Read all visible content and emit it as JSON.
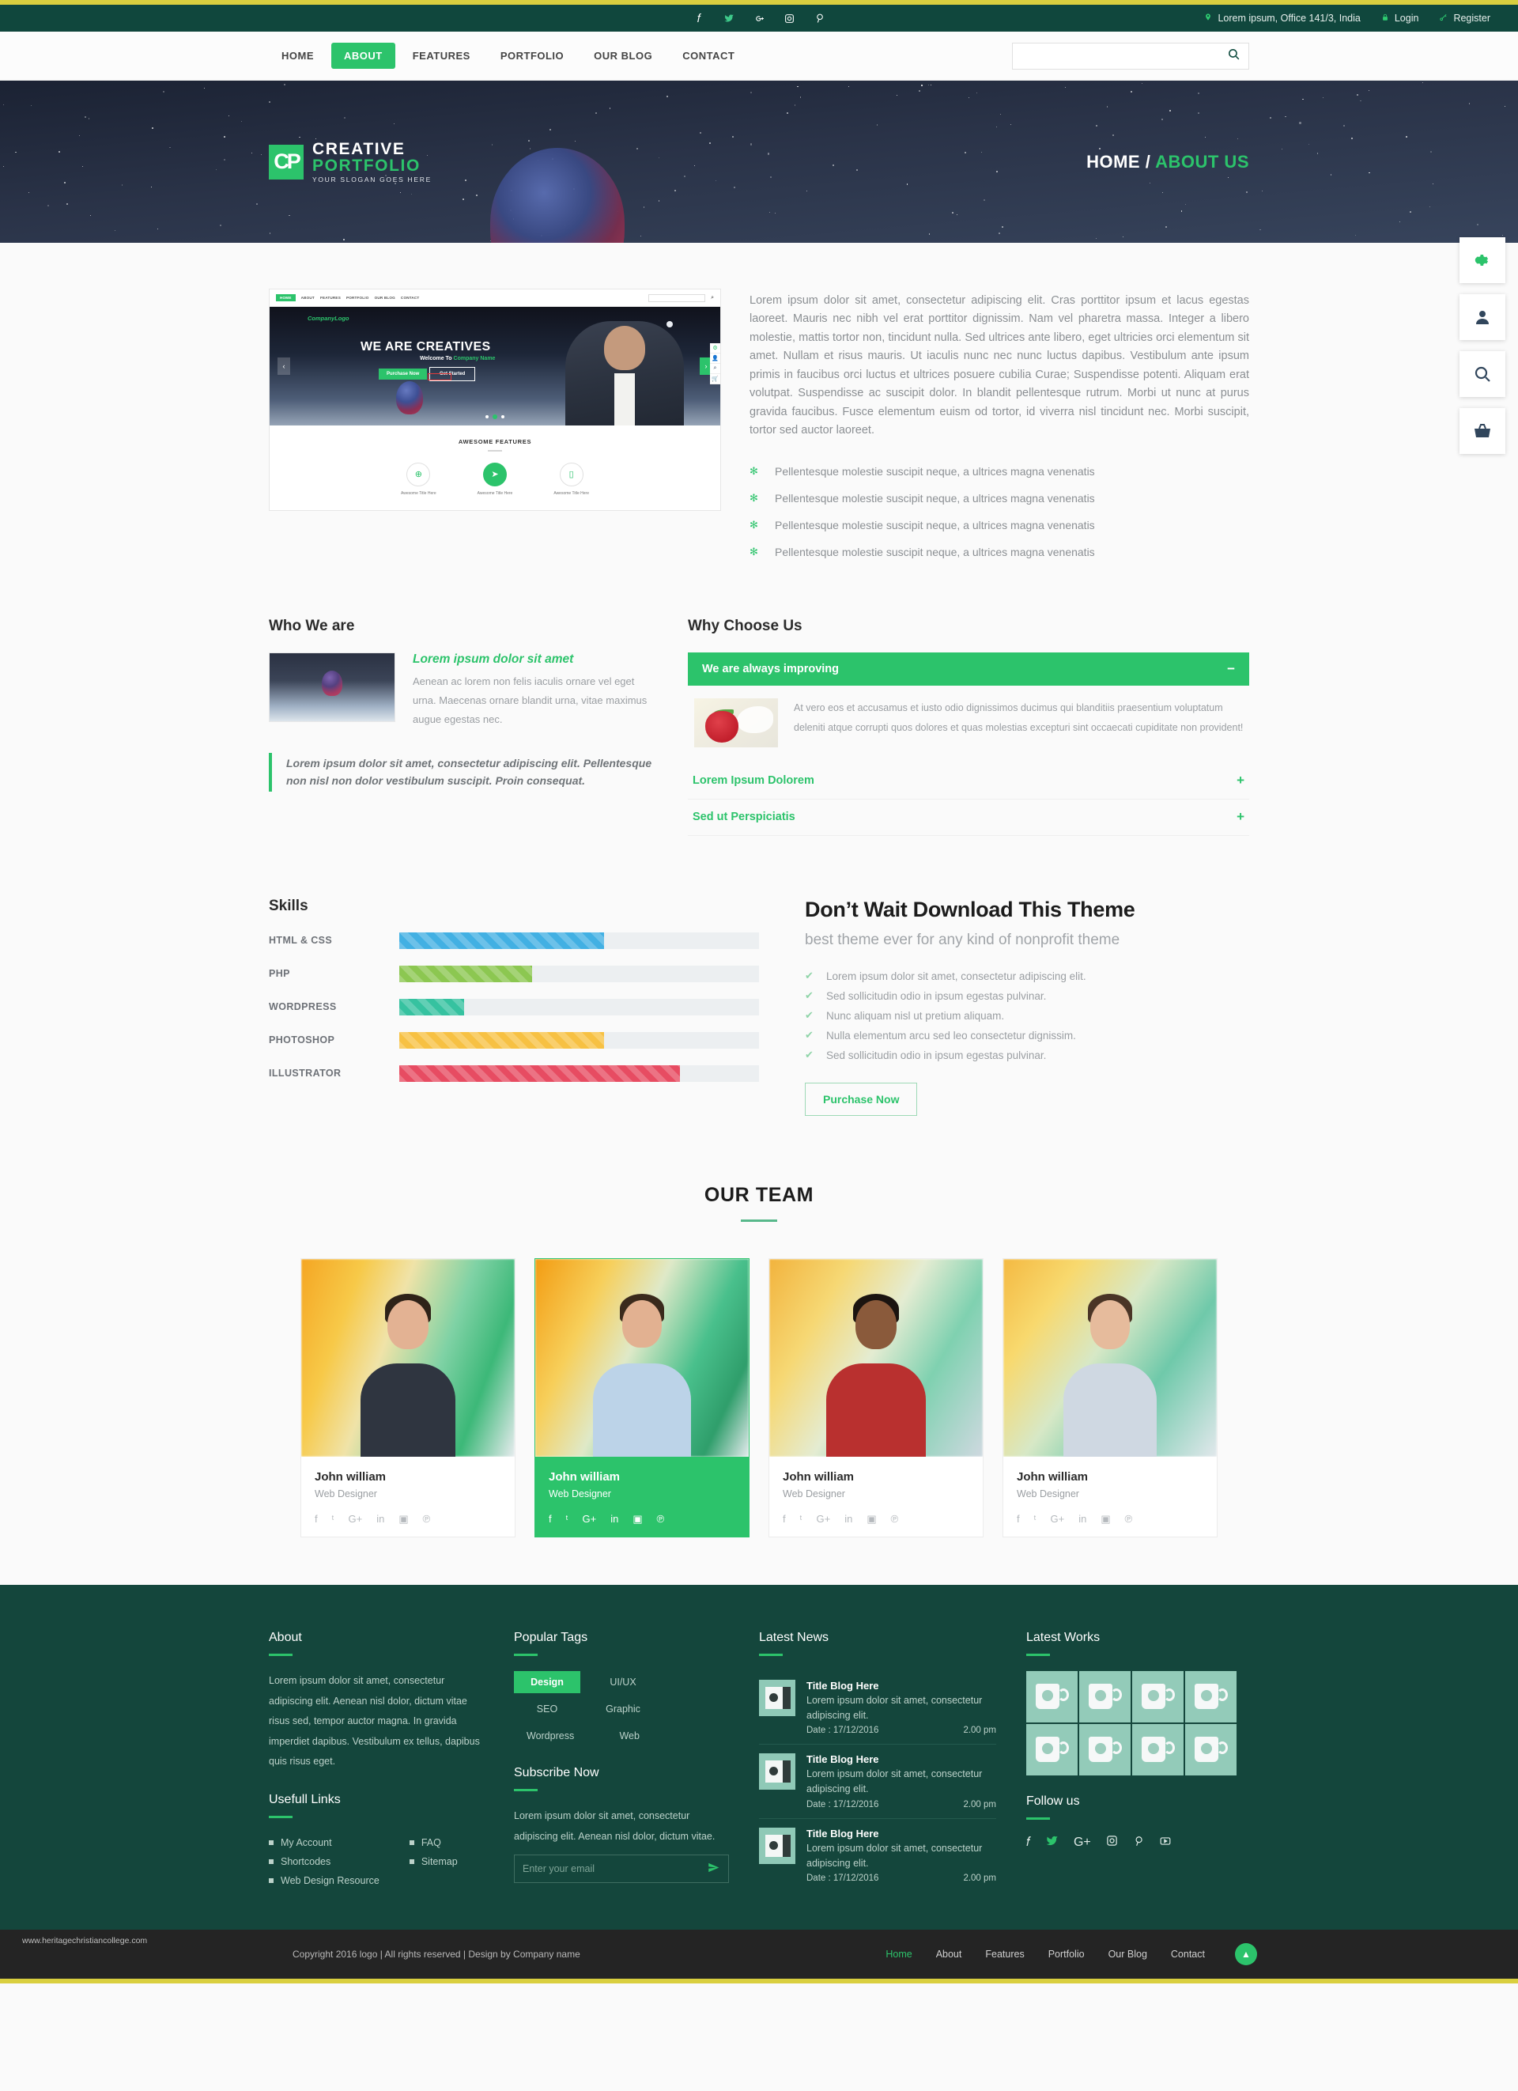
{
  "topbar": {
    "social": [
      {
        "name": "facebook-icon",
        "glyph": "f"
      },
      {
        "name": "twitter-icon",
        "glyph": "ᵗ"
      },
      {
        "name": "google-plus-icon",
        "glyph": "G"
      },
      {
        "name": "instagram-icon",
        "glyph": "▣"
      },
      {
        "name": "pinterest-icon",
        "glyph": "℗"
      }
    ],
    "address": "Lorem ipsum, Office 141/3, India",
    "login": "Login",
    "register": "Register"
  },
  "nav": {
    "items": [
      {
        "label": "HOME",
        "active": false
      },
      {
        "label": "ABOUT",
        "active": true
      },
      {
        "label": "FEATURES",
        "active": false
      },
      {
        "label": "PORTFOLIO",
        "active": false
      },
      {
        "label": "OUR BLOG",
        "active": false
      },
      {
        "label": "CONTACT",
        "active": false
      }
    ],
    "search_value": "",
    "search_placeholder": ""
  },
  "hero": {
    "logo_mark": "CP",
    "logo_line1": "CREATIVE",
    "logo_line2": "PORTFOLIO",
    "logo_slogan": "YOUR SLOGAN GOES HERE",
    "breadcrumb_home": "HOME",
    "breadcrumb_sep": "/",
    "breadcrumb_current": "ABOUT US"
  },
  "side_icons": [
    {
      "name": "gear-icon",
      "glyph": "⚙"
    },
    {
      "name": "user-icon",
      "glyph": "👤"
    },
    {
      "name": "search-icon",
      "glyph": "⚲"
    },
    {
      "name": "basket-icon",
      "glyph": "🛒"
    }
  ],
  "preview": {
    "nav": [
      "HOME",
      "ABOUT",
      "FEATURES",
      "PORTFOLIO",
      "OUR BLOG",
      "CONTACT"
    ],
    "company_logo": "CompanyLogo",
    "headline": "WE ARE CREATIVES",
    "sub_prefix": "Welcome To ",
    "sub_brand": "Company Name",
    "btn_primary": "Purchase Now",
    "btn_secondary": "Get Started",
    "features_title": "AWESOME FEATURES",
    "feature_items": [
      {
        "label": "Awesome Title Here",
        "icon": "globe-icon",
        "glyph": "⊕",
        "active": false
      },
      {
        "label": "Awesome Title Here",
        "icon": "rocket-icon",
        "glyph": "➤",
        "active": true
      },
      {
        "label": "Awesome Title Here",
        "icon": "mobile-icon",
        "glyph": "▯",
        "active": false
      }
    ]
  },
  "intro": {
    "paragraph": "Lorem ipsum dolor sit amet, consectetur adipiscing elit. Cras porttitor ipsum et lacus egestas laoreet. Mauris nec nibh vel erat porttitor dignissim. Nam vel pharetra massa. Integer a libero molestie, mattis tortor non, tincidunt nulla. Sed ultrices ante libero, eget ultricies orci elementum sit amet. Nullam et risus mauris. Ut iaculis nunc nec nunc luctus dapibus. Vestibulum ante ipsum primis in faucibus orci luctus et ultrices posuere cubilia Curae; Suspendisse potenti. Aliquam erat volutpat. Suspendisse ac suscipit dolor. In blandit pellentesque rutrum. Morbi ut nunc at purus gravida faucibus. Fusce elementum euism od tortor, id viverra nisl tincidunt nec. Morbi suscipit, tortor sed auctor laoreet.",
    "bullets": [
      "Pellentesque molestie suscipit neque, a ultrices magna venenatis",
      "Pellentesque molestie suscipit neque, a ultrices magna venenatis",
      "Pellentesque molestie suscipit neque, a ultrices magna venenatis",
      "Pellentesque molestie suscipit neque, a ultrices magna venenatis"
    ]
  },
  "who_we_are": {
    "heading": "Who We are",
    "item_title": "Lorem ipsum dolor sit amet",
    "item_text": "Aenean ac lorem non felis iaculis ornare vel eget urna. Maecenas ornare blandit urna, vitae maximus augue egestas nec.",
    "quote": "Lorem ipsum dolor sit amet, consectetur adipiscing elit. Pellentesque non nisl non dolor vestibulum suscipit. Proin consequat."
  },
  "why_choose_us": {
    "heading": "Why Choose Us",
    "open_panel": {
      "title": "We are always improving",
      "sign": "−",
      "text": "At vero eos et accusamus et iusto odio dignissimos ducimus qui blanditiis praesentium voluptatum deleniti atque corrupti quos dolores et quas molestias excepturi sint occaecati cupiditate non provident!"
    },
    "closed_panels": [
      {
        "title": "Lorem Ipsum Dolorem",
        "sign": "+"
      },
      {
        "title": "Sed ut Perspiciatis",
        "sign": "+"
      }
    ]
  },
  "skills": {
    "heading": "Skills",
    "items": [
      {
        "label": "HTML & CSS",
        "percent": 57,
        "color": "#42b0e3"
      },
      {
        "label": "PHP",
        "percent": 37,
        "color": "#8cc751"
      },
      {
        "label": "WORDPRESS",
        "percent": 18,
        "color": "#36c2a0"
      },
      {
        "label": "PHOTOSHOP",
        "percent": 57,
        "color": "#f7c143"
      },
      {
        "label": "ILLUSTRATOR",
        "percent": 78,
        "color": "#e74c62"
      }
    ]
  },
  "theme_promo": {
    "title": "Don’t Wait Download This Theme",
    "lead": "best theme ever for any kind of nonprofit theme",
    "items": [
      "Lorem ipsum dolor sit amet, consectetur adipiscing elit.",
      "Sed sollicitudin odio in ipsum egestas pulvinar.",
      "Nunc aliquam nisl ut pretium aliquam.",
      "Nulla elementum arcu sed leo consectetur dignissim.",
      "Sed sollicitudin odio in ipsum egestas pulvinar."
    ],
    "button": "Purchase Now"
  },
  "team": {
    "title": "OUR TEAM",
    "social": [
      {
        "name": "facebook-icon",
        "glyph": "f"
      },
      {
        "name": "twitter-icon",
        "glyph": "ᵗ"
      },
      {
        "name": "google-plus-icon",
        "glyph": "G+"
      },
      {
        "name": "linkedin-icon",
        "glyph": "in"
      },
      {
        "name": "instagram-icon",
        "glyph": "▣"
      },
      {
        "name": "pinterest-icon",
        "glyph": "℗"
      }
    ],
    "members": [
      {
        "name": "John william",
        "role": "Web Designer",
        "highlight": false
      },
      {
        "name": "John william",
        "role": "Web Designer",
        "highlight": true
      },
      {
        "name": "John william",
        "role": "Web Designer",
        "highlight": false
      },
      {
        "name": "John william",
        "role": "Web Designer",
        "highlight": false
      }
    ]
  },
  "footer": {
    "about": {
      "heading": "About",
      "text": "Lorem ipsum dolor sit amet, consectetur adipiscing elit. Aenean nisl dolor, dictum vitae risus sed, tempor auctor magna. In gravida imperdiet dapibus. Vestibulum ex tellus, dapibus quis risus eget."
    },
    "useful_links": {
      "heading": "Usefull Links",
      "col1": [
        "My Account",
        "Shortcodes",
        "Web Design Resource"
      ],
      "col2": [
        "FAQ",
        "Sitemap"
      ]
    },
    "popular_tags": {
      "heading": "Popular Tags",
      "tags": [
        {
          "label": "Design",
          "active": true
        },
        {
          "label": "UI/UX",
          "active": false
        },
        {
          "label": "SEO",
          "active": false
        },
        {
          "label": "Graphic",
          "active": false
        },
        {
          "label": "Wordpress",
          "active": false
        },
        {
          "label": "Web",
          "active": false
        }
      ]
    },
    "subscribe": {
      "heading": "Subscribe Now",
      "text": "Lorem ipsum dolor sit amet, consectetur adipiscing elit. Aenean nisl dolor, dictum vitae.",
      "placeholder": "Enter your email",
      "value": "",
      "send_icon": "send-icon"
    },
    "latest_news": {
      "heading": "Latest News",
      "items": [
        {
          "title": "Title Blog Here",
          "desc": "Lorem ipsum dolor sit amet, consectetur adipiscing elit.",
          "date": "Date : 17/12/2016",
          "time": "2.00 pm"
        },
        {
          "title": "Title Blog Here",
          "desc": "Lorem ipsum dolor sit amet, consectetur adipiscing elit.",
          "date": "Date : 17/12/2016",
          "time": "2.00 pm"
        },
        {
          "title": "Title Blog Here",
          "desc": "Lorem ipsum dolor sit amet, consectetur adipiscing elit.",
          "date": "Date : 17/12/2016",
          "time": "2.00 pm"
        }
      ]
    },
    "latest_works": {
      "heading": "Latest Works",
      "count": 8
    },
    "follow_us": {
      "heading": "Follow us",
      "icons": [
        {
          "name": "facebook-icon",
          "glyph": "f"
        },
        {
          "name": "twitter-icon",
          "glyph": "ᵗ"
        },
        {
          "name": "google-plus-icon",
          "glyph": "G+"
        },
        {
          "name": "instagram-icon",
          "glyph": "▣"
        },
        {
          "name": "pinterest-icon",
          "glyph": "℗"
        },
        {
          "name": "youtube-icon",
          "glyph": "▤"
        }
      ]
    }
  },
  "bottombar": {
    "watermark": "www.heritagechristiancollege.com",
    "copyright": "Copyright 2016 logo  |  All rights reserved  |  Design by Company name",
    "menu": [
      {
        "label": "Home",
        "active": true
      },
      {
        "label": "About",
        "active": false
      },
      {
        "label": "Features",
        "active": false
      },
      {
        "label": "Portfolio",
        "active": false
      },
      {
        "label": "Our Blog",
        "active": false
      },
      {
        "label": "Contact",
        "active": false
      }
    ],
    "gotop": "▲"
  },
  "colors": {
    "accent": "#2cc36b",
    "dark_green": "#14463c",
    "yellow": "#d9cf3f",
    "bottom": "#242424"
  }
}
